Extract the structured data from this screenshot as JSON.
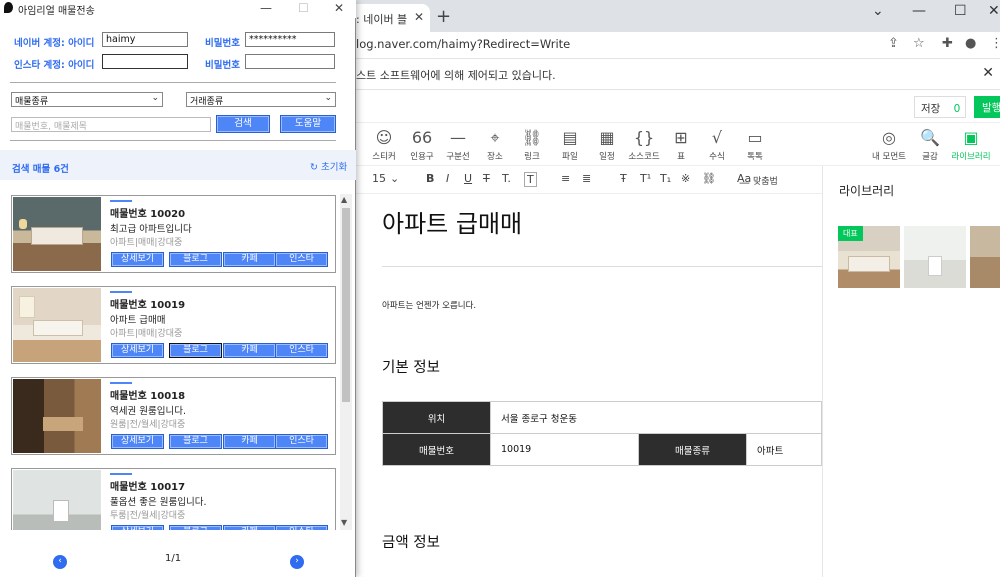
{
  "browser": {
    "tab_title": ": 네이버 블",
    "url": "log.naver.com/haimy?Redirect=Write",
    "infobar_msg": "스트 소프트웨어에 의해 제어되고 있습니다.",
    "save_label": "저장",
    "save_count": "0",
    "publish_label": "발행"
  },
  "toolbar": [
    {
      "label": "스티커",
      "icon": "☺"
    },
    {
      "label": "인용구",
      "icon": "66"
    },
    {
      "label": "구분선",
      "icon": "—"
    },
    {
      "label": "장소",
      "icon": "⌖"
    },
    {
      "label": "링크",
      "icon": "⛓"
    },
    {
      "label": "파일",
      "icon": "▤"
    },
    {
      "label": "일정",
      "icon": "▦"
    },
    {
      "label": "소스코드",
      "icon": "{}"
    },
    {
      "label": "표",
      "icon": "⊞"
    },
    {
      "label": "수식",
      "icon": "√"
    },
    {
      "label": "톡톡",
      "icon": "▭"
    },
    {
      "label": "내 모먼트",
      "icon": "◎"
    },
    {
      "label": "글감",
      "icon": "🔍"
    },
    {
      "label": "라이브러리",
      "icon": "▣"
    }
  ],
  "format": {
    "font_size": "15",
    "align_label": "맞춤법"
  },
  "doc": {
    "title": "아파트 급매매",
    "body_line": "아파트는 언젠가 오릅니다.",
    "section1": "기본 정보",
    "section2": "금액 정보",
    "table": {
      "h_location": "위치",
      "v_location": "서울 종로구 청운동",
      "h_number": "매물번호",
      "v_number": "10019",
      "h_type": "매물종류",
      "v_type": "아파트"
    }
  },
  "library": {
    "title": "라이브러리",
    "badge": "대표"
  },
  "app": {
    "title": "아임리얼 매물전송",
    "naver_label": "네이버 계정:  아이디",
    "naver_id": "haimy",
    "pw_label": "비밀번호",
    "naver_pw": "**********",
    "insta_label": "인스타 계정:  아이디",
    "insta_id": "",
    "insta_pw": "",
    "select_type": "매물종류",
    "select_deal": "거래종류",
    "search_placeholder": "매물번호, 매물제목",
    "search_btn": "검색",
    "help_btn": "도움말",
    "result_count": "검색 매물 6건",
    "reset": "초기화",
    "page": "1/1",
    "card_buttons": [
      "상세보기",
      "블로그",
      "카페",
      "인스타"
    ],
    "cards": [
      {
        "no": "매물번호 10020",
        "desc": "최고급 아파트입니다",
        "meta": "아파트|매매|강대중"
      },
      {
        "no": "매물번호 10019",
        "desc": "아파트 급매매",
        "meta": "아파트|매매|강대중"
      },
      {
        "no": "매물번호 10018",
        "desc": "역세권 원룸입니다.",
        "meta": "원룸|전/월세|강대중"
      },
      {
        "no": "매물번호 10017",
        "desc": "풀옵션 좋은 원룸입니다.",
        "meta": "투룸|전/월세|강대중"
      }
    ]
  }
}
